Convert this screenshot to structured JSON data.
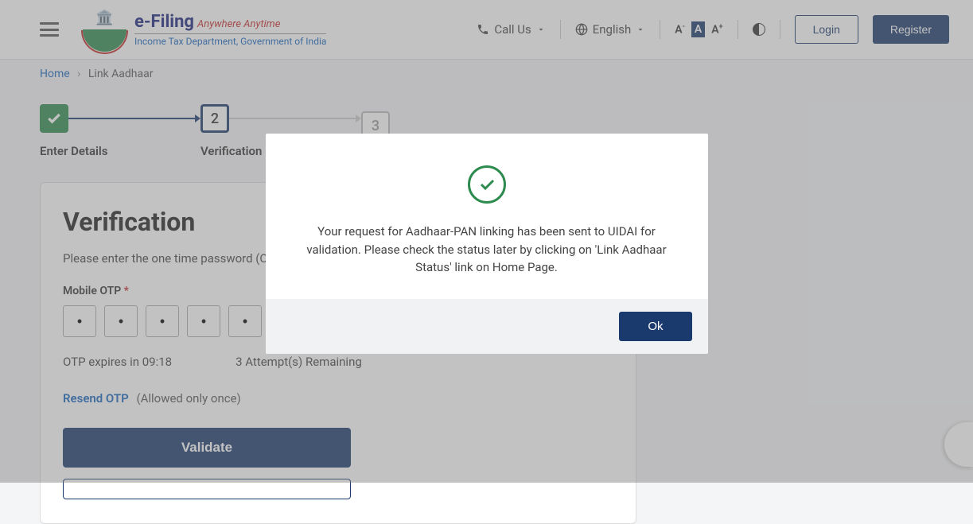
{
  "header": {
    "brand_main": "e-Filing",
    "brand_tag": "Anywhere Anytime",
    "brand_dept": "Income Tax Department, Government of India",
    "call_us": "Call Us",
    "language": "English",
    "login": "Login",
    "register": "Register"
  },
  "breadcrumb": {
    "home": "Home",
    "current": "Link Aadhaar"
  },
  "stepper": {
    "step1": {
      "label": "Enter Details"
    },
    "step2": {
      "num": "2",
      "label": "Verification"
    },
    "step3": {
      "num": "3",
      "label": ""
    }
  },
  "card": {
    "title": "Verification",
    "instruction": "Please enter the one time password (OTP)",
    "otp_label": "Mobile OTP",
    "otp_values": [
      "•",
      "•",
      "•",
      "•",
      "•",
      "•"
    ],
    "expiry_prefix": "OTP expires in ",
    "expiry_time": "09:18",
    "attempts": "3 Attempt(s) Remaining",
    "resend": "Resend OTP",
    "resend_hint": "(Allowed only once)",
    "validate": "Validate"
  },
  "modal": {
    "message": "Your request for Aadhaar-PAN linking has been sent to UIDAI for validation. Please check the status later by clicking on 'Link Aadhaar Status' link on Home Page.",
    "ok": "Ok"
  }
}
